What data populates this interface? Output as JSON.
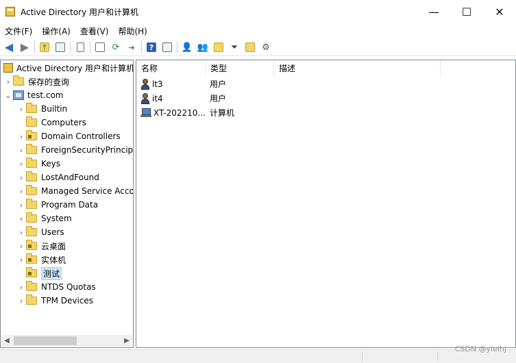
{
  "window": {
    "title": "Active Directory 用户和计算机",
    "minimize_glyph": "—",
    "maximize_glyph": "☐",
    "close_glyph": "✕"
  },
  "menu": [
    {
      "label": "文件(F)"
    },
    {
      "label": "操作(A)"
    },
    {
      "label": "查看(V)"
    },
    {
      "label": "帮助(H)"
    }
  ],
  "toolbar": {
    "icons": [
      "back-arrow-icon",
      "forward-arrow-icon",
      "up-folder-icon",
      "show-hide-tree-icon",
      "clipboard-icon",
      "properties-icon",
      "refresh-icon",
      "export-list-icon",
      "help-icon",
      "console-icon",
      "new-user-icon",
      "new-group-icon",
      "new-ou-icon",
      "filter-icon",
      "find-icon",
      "delegate-icon"
    ],
    "colors": {
      "arrow": "#2a6fc9",
      "help": "#2f5fb3"
    }
  },
  "tree": {
    "root_label": "Active Directory 用户和计算机",
    "saved_queries": "保存的查询",
    "domain": "test.com",
    "children": [
      {
        "label": "Builtin",
        "ou": false,
        "expandable": true
      },
      {
        "label": "Computers",
        "ou": false,
        "expandable": false
      },
      {
        "label": "Domain Controllers",
        "ou": true,
        "expandable": true
      },
      {
        "label": "ForeignSecurityPrincipals",
        "ou": false,
        "expandable": true
      },
      {
        "label": "Keys",
        "ou": false,
        "expandable": true
      },
      {
        "label": "LostAndFound",
        "ou": false,
        "expandable": true
      },
      {
        "label": "Managed Service Accounts",
        "ou": false,
        "expandable": true
      },
      {
        "label": "Program Data",
        "ou": false,
        "expandable": true
      },
      {
        "label": "System",
        "ou": false,
        "expandable": true
      },
      {
        "label": "Users",
        "ou": false,
        "expandable": true
      },
      {
        "label": "云桌面",
        "ou": true,
        "expandable": true
      },
      {
        "label": "实体机",
        "ou": true,
        "expandable": true
      },
      {
        "label": "测试",
        "ou": true,
        "expandable": false,
        "selected": true
      },
      {
        "label": "NTDS Quotas",
        "ou": false,
        "expandable": true
      },
      {
        "label": "TPM Devices",
        "ou": false,
        "expandable": true
      }
    ]
  },
  "list": {
    "columns": [
      "名称",
      "类型",
      "描述"
    ],
    "rows": [
      {
        "name": "lt3",
        "type": "用户",
        "icon": "user-icon"
      },
      {
        "name": "it4",
        "type": "用户",
        "icon": "user-icon"
      },
      {
        "name": "XT-202210...",
        "type": "计算机",
        "icon": "computer-icon"
      }
    ]
  },
  "watermark": "CSDN @yleihj"
}
